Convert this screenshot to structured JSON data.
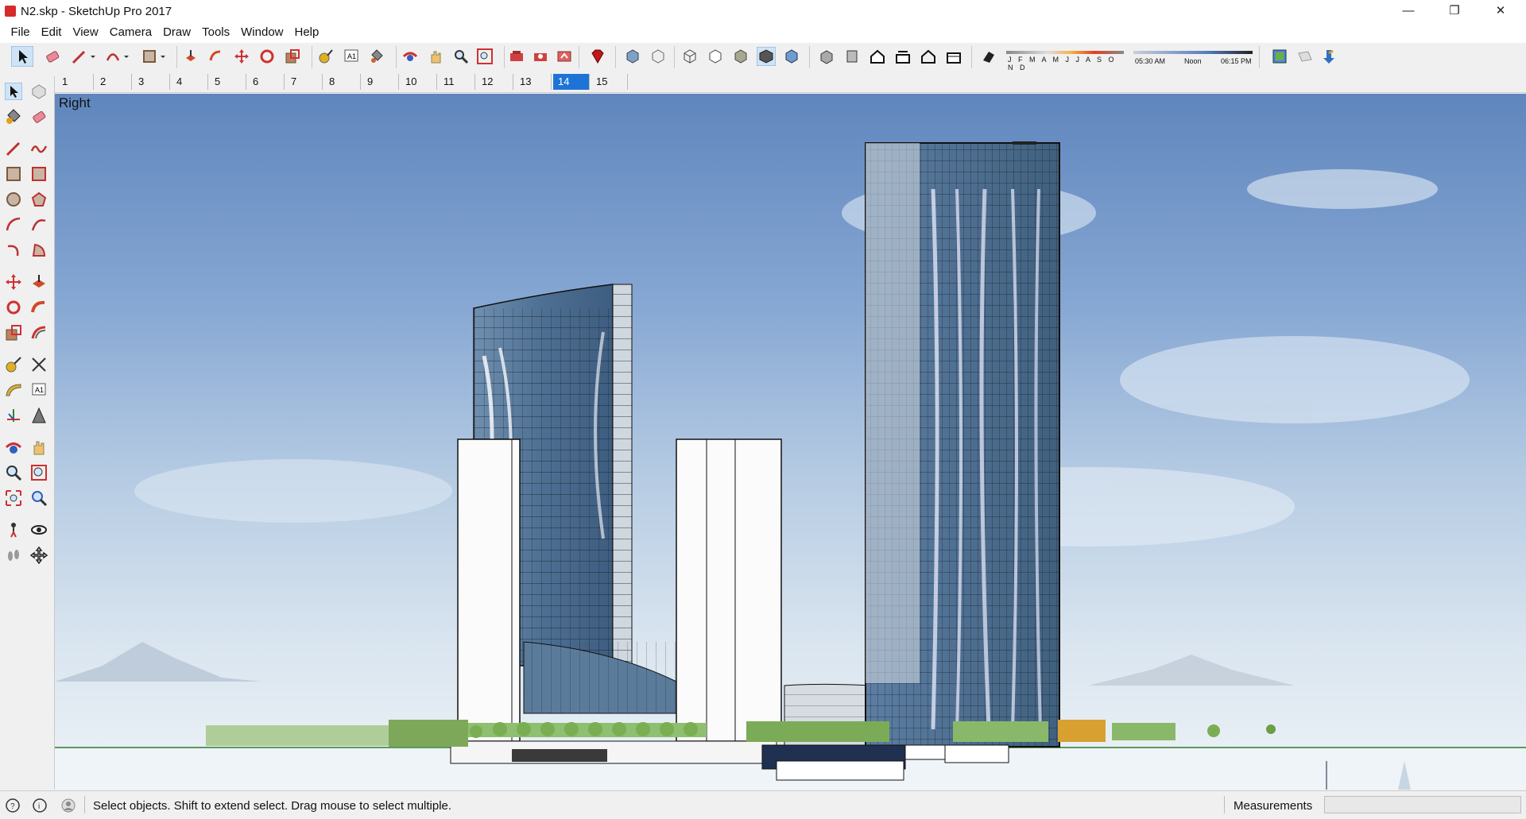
{
  "window": {
    "title": "N2.skp - SketchUp Pro 2017",
    "minimize": "—",
    "restore": "❐",
    "close": "✕"
  },
  "menu": [
    "File",
    "Edit",
    "View",
    "Camera",
    "Draw",
    "Tools",
    "Window",
    "Help"
  ],
  "shadow": {
    "months": "J F M A M J J A S O N D",
    "time_start": "05:30 AM",
    "time_mid": "Noon",
    "time_end": "06:15 PM"
  },
  "scenes": {
    "tabs": [
      "1",
      "2",
      "3",
      "4",
      "5",
      "6",
      "7",
      "8",
      "9",
      "10",
      "11",
      "12",
      "13",
      "14",
      "15"
    ],
    "active": "14"
  },
  "viewport": {
    "view_name": "Right"
  },
  "status": {
    "hint": "Select objects. Shift to extend select. Drag mouse to select multiple.",
    "measurements_label": "Measurements",
    "measurements_value": ""
  },
  "colors": {
    "accent": "#1e74d6",
    "sky_top": "#5f86bd",
    "glass": "#4d6f92"
  }
}
